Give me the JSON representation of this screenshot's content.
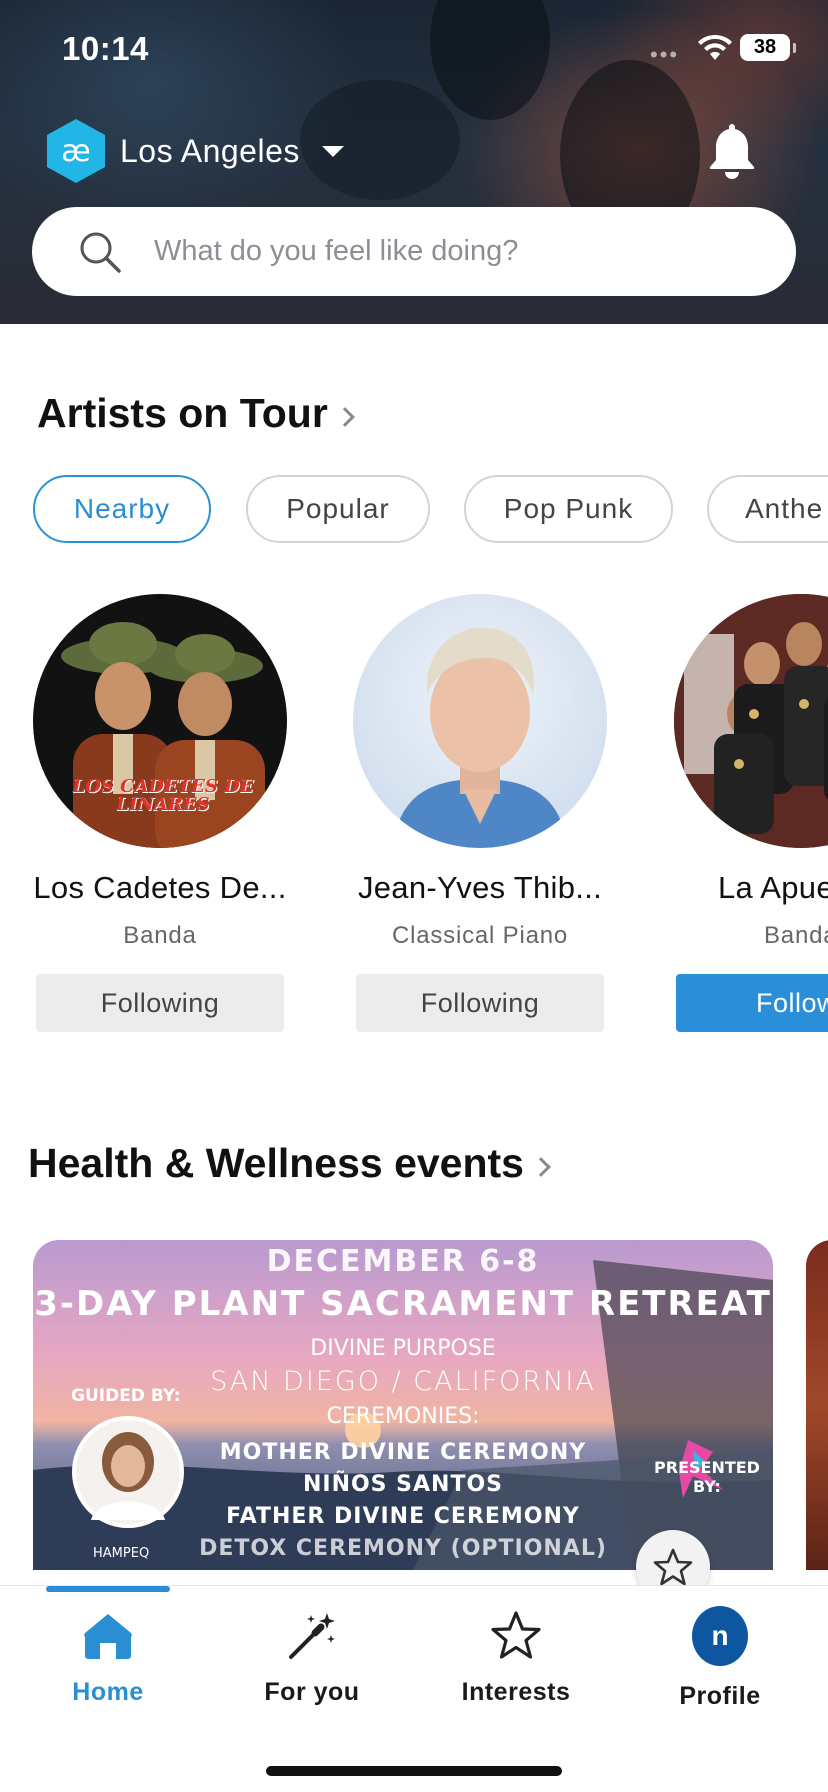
{
  "status_bar": {
    "time": "10:14",
    "battery": "38",
    "signal_icon": "signal-dots-icon",
    "wifi_icon": "wifi-icon"
  },
  "header": {
    "logo_icon": "app-logo-icon",
    "location": "Los Angeles",
    "location_caret_icon": "caret-down-icon",
    "notification_icon": "bell-icon"
  },
  "search": {
    "placeholder": "What do you feel like doing?",
    "value": "",
    "icon": "search-icon"
  },
  "artists_section": {
    "title": "Artists on Tour",
    "filters": [
      {
        "label": "Nearby",
        "active": true
      },
      {
        "label": "Popular",
        "active": false
      },
      {
        "label": "Pop Punk",
        "active": false
      },
      {
        "label": "Anthe",
        "active": false
      }
    ],
    "artists": [
      {
        "name": "Los Cadetes De...",
        "genre": "Banda",
        "follow_label": "Following",
        "photo_text": "LOS CADETES DE LINARES"
      },
      {
        "name": "Jean-Yves Thib...",
        "genre": "Classical Piano",
        "follow_label": "Following"
      },
      {
        "name": "La Apue",
        "genre": "Banda",
        "follow_label": "Follow"
      }
    ]
  },
  "health_section": {
    "title": "Health & Wellness events",
    "events": [
      {
        "poster": {
          "date": "DECEMBER 6-8",
          "headline": "3-DAY PLANT SACRAMENT RETREAT",
          "subtitle": "DIVINE PURPOSE",
          "location": "SAN DIEGO / CALIFORNIA",
          "ceremonies_label": "CEREMONIES:",
          "ceremonies": [
            "MOTHER DIVINE CEREMONY",
            "NIÑOS SANTOS",
            "FATHER DIVINE CEREMONY",
            "DETOX CEREMONY (OPTIONAL)"
          ],
          "guided_by": "GUIDED BY:",
          "guide_name": "HAMPEQ",
          "presented_by": "PRESENTED BY:"
        },
        "favorite_icon": "star-outline-icon"
      }
    ]
  },
  "tabbar": {
    "tabs": [
      {
        "label": "Home",
        "icon": "home-icon",
        "active": true
      },
      {
        "label": "For you",
        "icon": "magic-wand-icon",
        "active": false
      },
      {
        "label": "Interests",
        "icon": "star-icon",
        "active": false
      },
      {
        "label": "Profile",
        "icon": "profile-avatar-icon",
        "active": false,
        "avatar_letter": "n"
      }
    ]
  },
  "colors": {
    "accent": "#2a8ed2",
    "logo": "#22b6e6",
    "profile_avatar": "#0e57a0"
  }
}
